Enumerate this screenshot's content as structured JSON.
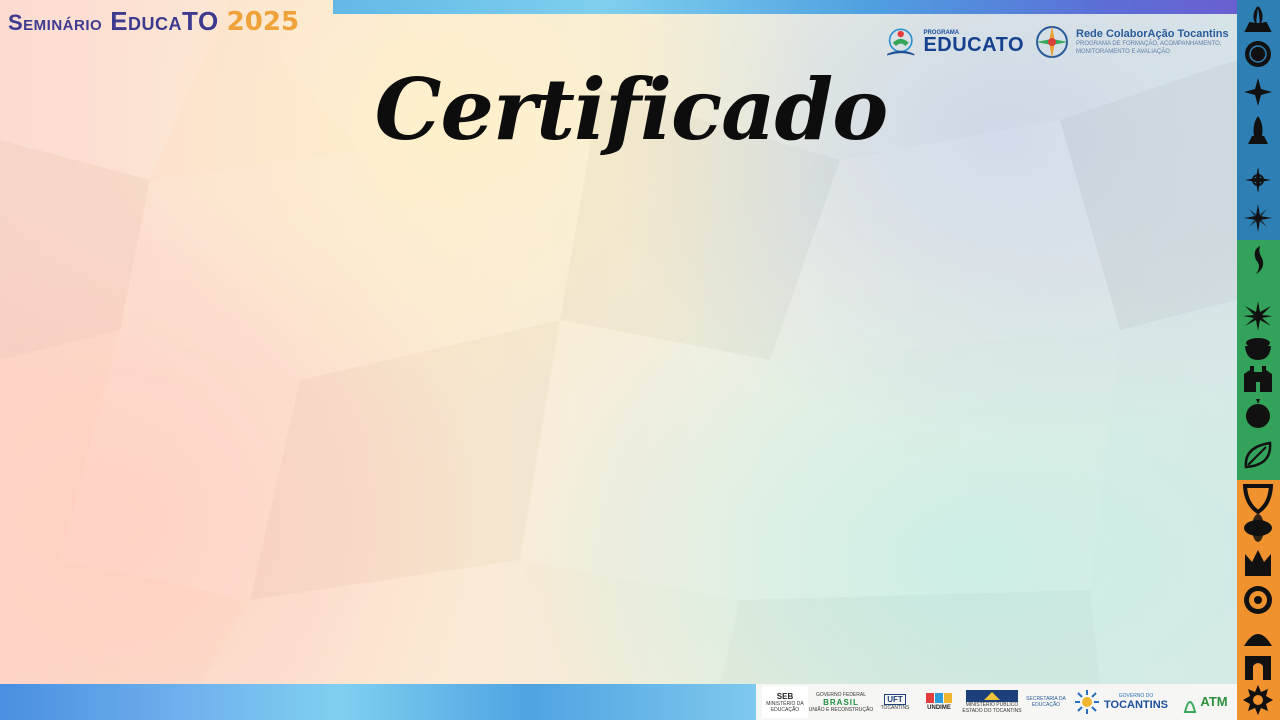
{
  "header": {
    "seminar_word": "Seminário",
    "seminar_brand": "EducaTO",
    "seminar_year": "2025",
    "programa_label": "PROGRAMA",
    "educato_logo": "EDUCATO",
    "rede_title": "Rede ColaborAção Tocantins",
    "rede_sub_1": "PROGRAMA DE FORMAÇÃO, ACOMPANHAMENTO,",
    "rede_sub_2": "MONITORAMENTO E AVALIAÇÃO"
  },
  "main": {
    "title": "Certificado"
  },
  "partners": {
    "seb": "SEB",
    "seb_sub_1": "MINISTÉRIO DA",
    "seb_sub_2": "EDUCAÇÃO",
    "gov_label": "GOVERNO FEDERAL",
    "brasil": "BRASIL",
    "brasil_sub": "UNIÃO E RECONSTRUÇÃO",
    "uft": "UFT",
    "uft_sub": "TOCANTINS",
    "undime": "UNDIME",
    "mp_1": "MINISTÉRIO PÚBLICO",
    "mp_2": "ESTADO DO TOCANTINS",
    "sec_1": "SECRETARIA DA",
    "sec_2": "EDUCAÇÃO",
    "gov_to_label": "GOVERNO DO",
    "tocantins": "TOCANTINS",
    "atm": "ATM"
  },
  "colors": {
    "title": "#0d0d0d",
    "seminar_purple": "#3d3a8f",
    "seminar_orange": "#f0a23a",
    "band_blue": "#2e7fb3",
    "band_green": "#33a25a",
    "band_orange": "#f0932f"
  },
  "band_icons": {
    "blue": [
      "capim-icon",
      "sun-disc-icon",
      "compass-icon",
      "rocket-icon",
      "star-compass-icon",
      "wind-rose-icon"
    ],
    "green": [
      "bird-icon",
      "sun-burst-icon",
      "bowl-icon",
      "church-icon",
      "fruit-icon",
      "leaf-icon"
    ],
    "orange": [
      "shield-icon",
      "flower-icon",
      "crown-icon",
      "ring-flower-icon",
      "dome-icon",
      "arch-icon",
      "sunflower-icon"
    ]
  }
}
